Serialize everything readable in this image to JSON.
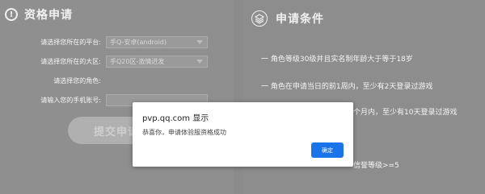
{
  "left": {
    "title": "资格申请",
    "rows": [
      {
        "label": "请选择您所在的平台:",
        "value": "手Q-安卓(android)"
      },
      {
        "label": "请选择您所在的大区:",
        "value": "手Q20区-激情迸发"
      },
      {
        "label": "请选择您的角色:",
        "value": ""
      },
      {
        "label": "请输入您的手机账号:",
        "value": ""
      }
    ],
    "submit_label": "提交申请"
  },
  "right": {
    "title": "申请条件",
    "conditions": [
      "一 角色等级30级并且实名制年龄大于等于18岁",
      "一 角色在申请当日的前1周内，至少有2天登录过游戏",
      "个月内，至少有10天登录过游戏",
      "信誉等级>=5"
    ]
  },
  "dialog": {
    "title": "pvp.qq.com 显示",
    "message": "恭喜你，申请体验服资格成功",
    "ok_label": "确定"
  }
}
